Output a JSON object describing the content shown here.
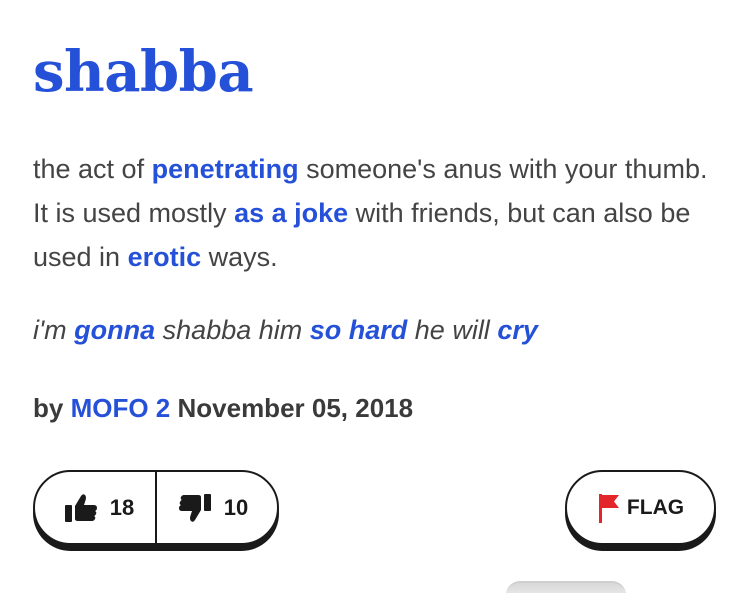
{
  "definition": {
    "word": "shabba",
    "meaning": [
      {
        "text": "the act of ",
        "link": false
      },
      {
        "text": "penetrating",
        "link": true
      },
      {
        "text": " someone's anus with your thumb. It is used mostly ",
        "link": false
      },
      {
        "text": "as a joke",
        "link": true
      },
      {
        "text": " with friends, but can also be used in ",
        "link": false
      },
      {
        "text": "erotic",
        "link": true
      },
      {
        "text": " ways.",
        "link": false
      }
    ],
    "example": [
      {
        "text": "i'm ",
        "link": false
      },
      {
        "text": "gonna",
        "link": true
      },
      {
        "text": " shabba him ",
        "link": false
      },
      {
        "text": "so hard",
        "link": true
      },
      {
        "text": " he will ",
        "link": false
      },
      {
        "text": "cry",
        "link": true
      }
    ],
    "by_label": "by",
    "author": "MOFO 2",
    "date": "November 05, 2018"
  },
  "votes": {
    "up_count": "18",
    "down_count": "10",
    "up_icon": "thumbs-up-icon",
    "down_icon": "thumbs-down-icon"
  },
  "flag": {
    "label": "FLAG",
    "icon": "flag-icon"
  },
  "colors": {
    "link": "#2550d8",
    "text": "#444444",
    "border": "#1a1a1a",
    "flag": "#e3262a"
  }
}
